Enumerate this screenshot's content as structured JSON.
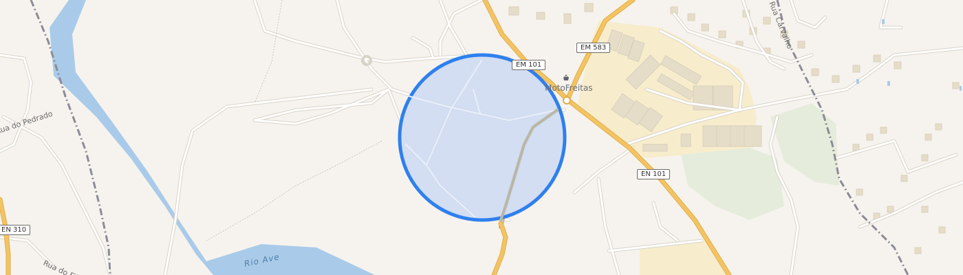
{
  "map": {
    "labels": {
      "road_em101": "EM 101",
      "road_em583": "EM 583",
      "road_en101": "EN 101",
      "road_en310": "EN 310",
      "poi": "MotoFreitas",
      "street_pedrado": "Rua do Pedrado",
      "street_fijo": "Rua do Fijô",
      "street_carvalho": "Rua Carvalho",
      "river": "Rio Ave"
    },
    "icons": {
      "poi": "shopping-basket-icon"
    },
    "colors": {
      "background": "#f6f3ee",
      "river": "#a9cbe9",
      "primary_road": "#f2c463",
      "trail": "#c9c7b4",
      "railway": "#8b8b95",
      "accuracy_circle_fill": "#cfdcf2",
      "accuracy_circle_stroke": "#2f80ed",
      "industrial_zone": "#f7edcc",
      "green_area": "#e5ecdb"
    }
  }
}
